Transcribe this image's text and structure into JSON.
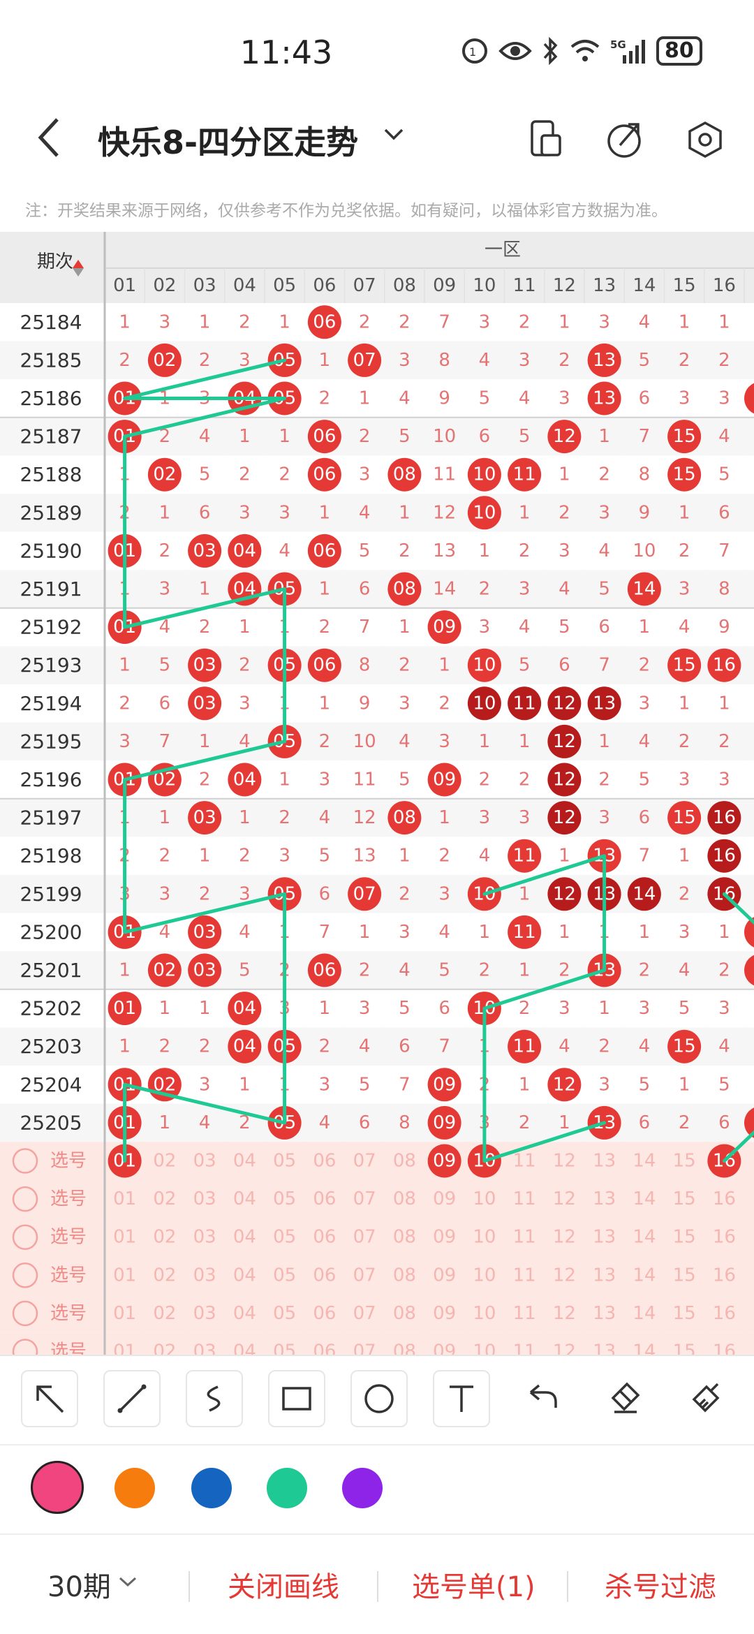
{
  "status": {
    "time": "11:43",
    "battery": "80"
  },
  "header": {
    "title": "快乐8-四分区走势"
  },
  "notice": "注：开奖结果来源于网络，仅供参考不作为兑奖依据。如有疑问，以福体彩官方数据为准。",
  "table": {
    "period_header": "期次",
    "zone_label": "一区",
    "columns": [
      "01",
      "02",
      "03",
      "04",
      "05",
      "06",
      "07",
      "08",
      "09",
      "10",
      "11",
      "12",
      "13",
      "14",
      "15",
      "16"
    ],
    "rows": [
      {
        "period": "25184",
        "vals": [
          1,
          3,
          1,
          2,
          1,
          6,
          2,
          2,
          7,
          3,
          2,
          1,
          3,
          4,
          1,
          1
        ],
        "extra": "",
        "drawn": [
          6
        ],
        "streak": []
      },
      {
        "period": "25185",
        "vals": [
          2,
          2,
          2,
          3,
          5,
          1,
          7,
          3,
          8,
          4,
          3,
          2,
          13,
          5,
          2,
          2
        ],
        "extra": "",
        "drawn": [
          2,
          5,
          7,
          13
        ],
        "streak": []
      },
      {
        "period": "25186",
        "vals": [
          1,
          1,
          3,
          4,
          5,
          2,
          1,
          4,
          9,
          5,
          4,
          3,
          13,
          6,
          3,
          3
        ],
        "extra": "dot",
        "drawn": [
          1,
          4,
          5,
          13
        ],
        "streak": []
      },
      {
        "period": "25187",
        "vals": [
          1,
          2,
          4,
          1,
          1,
          6,
          2,
          5,
          10,
          6,
          5,
          12,
          1,
          7,
          15,
          4
        ],
        "extra": "",
        "drawn": [
          1,
          6,
          12,
          15
        ],
        "streak": []
      },
      {
        "period": "25188",
        "vals": [
          1,
          2,
          5,
          2,
          2,
          6,
          3,
          8,
          11,
          10,
          11,
          1,
          2,
          8,
          15,
          5
        ],
        "extra": "",
        "drawn": [
          2,
          6,
          8,
          10,
          11,
          15
        ],
        "streak": []
      },
      {
        "period": "25189",
        "vals": [
          2,
          1,
          6,
          3,
          3,
          1,
          4,
          1,
          12,
          10,
          1,
          2,
          3,
          9,
          1,
          6
        ],
        "extra": "",
        "drawn": [
          10
        ],
        "streak": []
      },
      {
        "period": "25190",
        "vals": [
          1,
          2,
          3,
          4,
          4,
          6,
          5,
          2,
          13,
          1,
          2,
          3,
          4,
          10,
          2,
          7
        ],
        "extra": "",
        "drawn": [
          1,
          3,
          4,
          6
        ],
        "streak": []
      },
      {
        "period": "25191",
        "vals": [
          1,
          3,
          1,
          4,
          5,
          1,
          6,
          8,
          14,
          2,
          3,
          4,
          5,
          14,
          3,
          8
        ],
        "extra": "",
        "drawn": [
          4,
          5,
          8,
          14
        ],
        "streak": []
      },
      {
        "period": "25192",
        "vals": [
          1,
          4,
          2,
          1,
          1,
          2,
          7,
          1,
          9,
          3,
          4,
          5,
          6,
          1,
          4,
          9
        ],
        "extra": "",
        "drawn": [
          1,
          9
        ],
        "streak": []
      },
      {
        "period": "25193",
        "vals": [
          1,
          5,
          3,
          2,
          5,
          6,
          8,
          2,
          1,
          10,
          5,
          6,
          7,
          2,
          15,
          16
        ],
        "extra": "",
        "drawn": [
          3,
          5,
          6,
          10,
          15,
          16
        ],
        "streak": []
      },
      {
        "period": "25194",
        "vals": [
          2,
          6,
          3,
          3,
          1,
          1,
          9,
          3,
          2,
          10,
          11,
          12,
          13,
          3,
          1,
          1
        ],
        "extra": "",
        "drawn": [
          3,
          10,
          11,
          12,
          13
        ],
        "streak": [
          10,
          11,
          12,
          13
        ]
      },
      {
        "period": "25195",
        "vals": [
          3,
          7,
          1,
          4,
          5,
          2,
          10,
          4,
          3,
          1,
          1,
          12,
          1,
          4,
          2,
          2
        ],
        "extra": "",
        "drawn": [
          5,
          12
        ],
        "streak": [
          12
        ]
      },
      {
        "period": "25196",
        "vals": [
          1,
          2,
          2,
          4,
          1,
          3,
          11,
          5,
          9,
          2,
          2,
          12,
          2,
          5,
          3,
          3
        ],
        "extra": "",
        "drawn": [
          1,
          2,
          4,
          9,
          12
        ],
        "streak": [
          12
        ]
      },
      {
        "period": "25197",
        "vals": [
          1,
          1,
          3,
          1,
          2,
          4,
          12,
          8,
          1,
          3,
          3,
          12,
          3,
          6,
          15,
          16
        ],
        "extra": "",
        "drawn": [
          3,
          8,
          12,
          15,
          16
        ],
        "streak": [
          12,
          16
        ]
      },
      {
        "period": "25198",
        "vals": [
          2,
          2,
          1,
          2,
          3,
          5,
          13,
          1,
          2,
          4,
          11,
          1,
          13,
          7,
          1,
          16
        ],
        "extra": "",
        "drawn": [
          11,
          13,
          16
        ],
        "streak": [
          16
        ]
      },
      {
        "period": "25199",
        "vals": [
          3,
          3,
          2,
          3,
          5,
          6,
          7,
          2,
          3,
          10,
          1,
          12,
          13,
          14,
          2,
          16
        ],
        "extra": "",
        "drawn": [
          5,
          7,
          10,
          12,
          13,
          14,
          16
        ],
        "streak": [
          12,
          13,
          14,
          16
        ]
      },
      {
        "period": "25200",
        "vals": [
          1,
          4,
          3,
          4,
          1,
          7,
          1,
          3,
          4,
          1,
          11,
          1,
          1,
          1,
          3,
          1
        ],
        "extra": "dot",
        "drawn": [
          1,
          3,
          11
        ],
        "streak": []
      },
      {
        "period": "25201",
        "vals": [
          1,
          2,
          3,
          5,
          2,
          6,
          2,
          4,
          5,
          2,
          1,
          2,
          13,
          2,
          4,
          2
        ],
        "extra": "dot",
        "drawn": [
          2,
          3,
          6,
          13
        ],
        "streak": []
      },
      {
        "period": "25202",
        "vals": [
          1,
          1,
          1,
          4,
          3,
          1,
          3,
          5,
          6,
          10,
          2,
          3,
          1,
          3,
          5,
          3
        ],
        "extra": "",
        "drawn": [
          1,
          4,
          10
        ],
        "streak": []
      },
      {
        "period": "25203",
        "vals": [
          1,
          2,
          2,
          4,
          5,
          2,
          4,
          6,
          7,
          1,
          11,
          4,
          2,
          4,
          15,
          4
        ],
        "extra": "",
        "drawn": [
          4,
          5,
          11,
          15
        ],
        "streak": []
      },
      {
        "period": "25204",
        "vals": [
          1,
          2,
          3,
          1,
          1,
          3,
          5,
          7,
          9,
          2,
          1,
          12,
          3,
          5,
          1,
          5
        ],
        "extra": "",
        "drawn": [
          1,
          2,
          9,
          12
        ],
        "streak": []
      },
      {
        "period": "25205",
        "vals": [
          1,
          1,
          4,
          2,
          5,
          4,
          6,
          8,
          9,
          3,
          2,
          1,
          13,
          6,
          2,
          6
        ],
        "extra": "dot",
        "drawn": [
          1,
          5,
          9,
          13
        ],
        "streak": []
      }
    ],
    "pick_label": "选号",
    "pick_rows": 6,
    "pick_selected": [
      1,
      9,
      10,
      16
    ]
  },
  "draw_lines": [
    [
      [
        5,
        25185
      ],
      [
        1,
        25186
      ],
      [
        5,
        25186
      ],
      [
        1,
        25187
      ],
      [
        1,
        25190
      ],
      [
        1,
        25192
      ],
      [
        5,
        25191
      ],
      [
        5,
        25195
      ],
      [
        1,
        25196
      ],
      [
        1,
        25200
      ],
      [
        5,
        25199
      ],
      [
        5,
        25205
      ],
      [
        1,
        25204
      ],
      [
        1,
        "pick"
      ]
    ],
    [
      [
        10,
        25199
      ],
      [
        13,
        25198
      ],
      [
        13,
        25201
      ],
      [
        10,
        25202
      ],
      [
        10,
        "pick"
      ],
      [
        13,
        25205
      ]
    ],
    [
      [
        16,
        25199
      ],
      [
        17,
        25200
      ]
    ],
    [
      [
        16,
        "pick"
      ],
      [
        17,
        25205
      ]
    ]
  ],
  "tools": [
    "arrow-tool",
    "line-tool",
    "curve-tool",
    "rect-tool",
    "circle-tool",
    "text-tool",
    "undo-tool",
    "eraser-tool",
    "clear-tool"
  ],
  "colors": [
    "#f0457f",
    "#f67c0e",
    "#1565c0",
    "#1ec993",
    "#8e24e8"
  ],
  "bottom": {
    "period": "30期",
    "close_label": "关闭画线",
    "pick_label": "选号单(1)",
    "filter_label": "杀号过滤"
  }
}
